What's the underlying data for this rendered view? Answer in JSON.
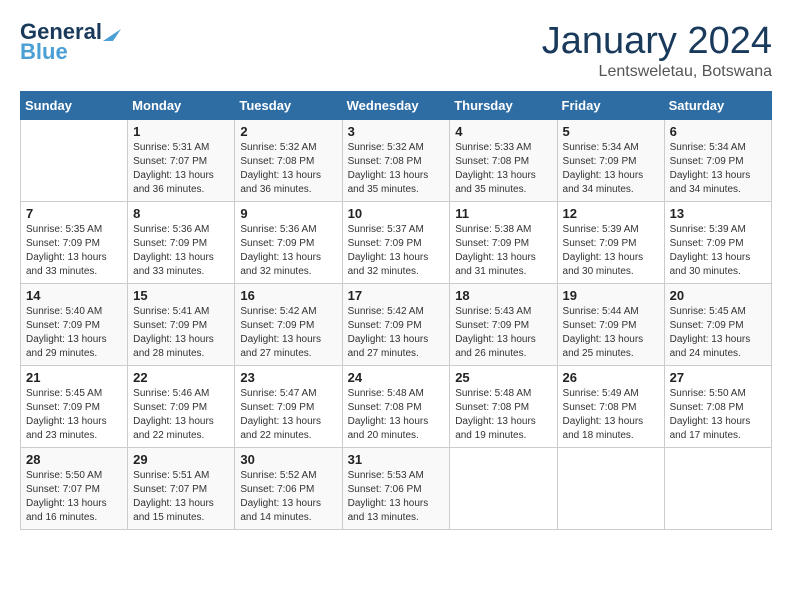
{
  "header": {
    "logo_line1": "General",
    "logo_line2": "Blue",
    "title": "January 2024",
    "subtitle": "Lentsweletau, Botswana"
  },
  "days_of_week": [
    "Sunday",
    "Monday",
    "Tuesday",
    "Wednesday",
    "Thursday",
    "Friday",
    "Saturday"
  ],
  "weeks": [
    [
      {
        "day": "",
        "sunrise": "",
        "sunset": "",
        "daylight": ""
      },
      {
        "day": "1",
        "sunrise": "Sunrise: 5:31 AM",
        "sunset": "Sunset: 7:07 PM",
        "daylight": "Daylight: 13 hours and 36 minutes."
      },
      {
        "day": "2",
        "sunrise": "Sunrise: 5:32 AM",
        "sunset": "Sunset: 7:08 PM",
        "daylight": "Daylight: 13 hours and 36 minutes."
      },
      {
        "day": "3",
        "sunrise": "Sunrise: 5:32 AM",
        "sunset": "Sunset: 7:08 PM",
        "daylight": "Daylight: 13 hours and 35 minutes."
      },
      {
        "day": "4",
        "sunrise": "Sunrise: 5:33 AM",
        "sunset": "Sunset: 7:08 PM",
        "daylight": "Daylight: 13 hours and 35 minutes."
      },
      {
        "day": "5",
        "sunrise": "Sunrise: 5:34 AM",
        "sunset": "Sunset: 7:09 PM",
        "daylight": "Daylight: 13 hours and 34 minutes."
      },
      {
        "day": "6",
        "sunrise": "Sunrise: 5:34 AM",
        "sunset": "Sunset: 7:09 PM",
        "daylight": "Daylight: 13 hours and 34 minutes."
      }
    ],
    [
      {
        "day": "7",
        "sunrise": "Sunrise: 5:35 AM",
        "sunset": "Sunset: 7:09 PM",
        "daylight": "Daylight: 13 hours and 33 minutes."
      },
      {
        "day": "8",
        "sunrise": "Sunrise: 5:36 AM",
        "sunset": "Sunset: 7:09 PM",
        "daylight": "Daylight: 13 hours and 33 minutes."
      },
      {
        "day": "9",
        "sunrise": "Sunrise: 5:36 AM",
        "sunset": "Sunset: 7:09 PM",
        "daylight": "Daylight: 13 hours and 32 minutes."
      },
      {
        "day": "10",
        "sunrise": "Sunrise: 5:37 AM",
        "sunset": "Sunset: 7:09 PM",
        "daylight": "Daylight: 13 hours and 32 minutes."
      },
      {
        "day": "11",
        "sunrise": "Sunrise: 5:38 AM",
        "sunset": "Sunset: 7:09 PM",
        "daylight": "Daylight: 13 hours and 31 minutes."
      },
      {
        "day": "12",
        "sunrise": "Sunrise: 5:39 AM",
        "sunset": "Sunset: 7:09 PM",
        "daylight": "Daylight: 13 hours and 30 minutes."
      },
      {
        "day": "13",
        "sunrise": "Sunrise: 5:39 AM",
        "sunset": "Sunset: 7:09 PM",
        "daylight": "Daylight: 13 hours and 30 minutes."
      }
    ],
    [
      {
        "day": "14",
        "sunrise": "Sunrise: 5:40 AM",
        "sunset": "Sunset: 7:09 PM",
        "daylight": "Daylight: 13 hours and 29 minutes."
      },
      {
        "day": "15",
        "sunrise": "Sunrise: 5:41 AM",
        "sunset": "Sunset: 7:09 PM",
        "daylight": "Daylight: 13 hours and 28 minutes."
      },
      {
        "day": "16",
        "sunrise": "Sunrise: 5:42 AM",
        "sunset": "Sunset: 7:09 PM",
        "daylight": "Daylight: 13 hours and 27 minutes."
      },
      {
        "day": "17",
        "sunrise": "Sunrise: 5:42 AM",
        "sunset": "Sunset: 7:09 PM",
        "daylight": "Daylight: 13 hours and 27 minutes."
      },
      {
        "day": "18",
        "sunrise": "Sunrise: 5:43 AM",
        "sunset": "Sunset: 7:09 PM",
        "daylight": "Daylight: 13 hours and 26 minutes."
      },
      {
        "day": "19",
        "sunrise": "Sunrise: 5:44 AM",
        "sunset": "Sunset: 7:09 PM",
        "daylight": "Daylight: 13 hours and 25 minutes."
      },
      {
        "day": "20",
        "sunrise": "Sunrise: 5:45 AM",
        "sunset": "Sunset: 7:09 PM",
        "daylight": "Daylight: 13 hours and 24 minutes."
      }
    ],
    [
      {
        "day": "21",
        "sunrise": "Sunrise: 5:45 AM",
        "sunset": "Sunset: 7:09 PM",
        "daylight": "Daylight: 13 hours and 23 minutes."
      },
      {
        "day": "22",
        "sunrise": "Sunrise: 5:46 AM",
        "sunset": "Sunset: 7:09 PM",
        "daylight": "Daylight: 13 hours and 22 minutes."
      },
      {
        "day": "23",
        "sunrise": "Sunrise: 5:47 AM",
        "sunset": "Sunset: 7:09 PM",
        "daylight": "Daylight: 13 hours and 22 minutes."
      },
      {
        "day": "24",
        "sunrise": "Sunrise: 5:48 AM",
        "sunset": "Sunset: 7:08 PM",
        "daylight": "Daylight: 13 hours and 20 minutes."
      },
      {
        "day": "25",
        "sunrise": "Sunrise: 5:48 AM",
        "sunset": "Sunset: 7:08 PM",
        "daylight": "Daylight: 13 hours and 19 minutes."
      },
      {
        "day": "26",
        "sunrise": "Sunrise: 5:49 AM",
        "sunset": "Sunset: 7:08 PM",
        "daylight": "Daylight: 13 hours and 18 minutes."
      },
      {
        "day": "27",
        "sunrise": "Sunrise: 5:50 AM",
        "sunset": "Sunset: 7:08 PM",
        "daylight": "Daylight: 13 hours and 17 minutes."
      }
    ],
    [
      {
        "day": "28",
        "sunrise": "Sunrise: 5:50 AM",
        "sunset": "Sunset: 7:07 PM",
        "daylight": "Daylight: 13 hours and 16 minutes."
      },
      {
        "day": "29",
        "sunrise": "Sunrise: 5:51 AM",
        "sunset": "Sunset: 7:07 PM",
        "daylight": "Daylight: 13 hours and 15 minutes."
      },
      {
        "day": "30",
        "sunrise": "Sunrise: 5:52 AM",
        "sunset": "Sunset: 7:06 PM",
        "daylight": "Daylight: 13 hours and 14 minutes."
      },
      {
        "day": "31",
        "sunrise": "Sunrise: 5:53 AM",
        "sunset": "Sunset: 7:06 PM",
        "daylight": "Daylight: 13 hours and 13 minutes."
      },
      {
        "day": "",
        "sunrise": "",
        "sunset": "",
        "daylight": ""
      },
      {
        "day": "",
        "sunrise": "",
        "sunset": "",
        "daylight": ""
      },
      {
        "day": "",
        "sunrise": "",
        "sunset": "",
        "daylight": ""
      }
    ]
  ]
}
